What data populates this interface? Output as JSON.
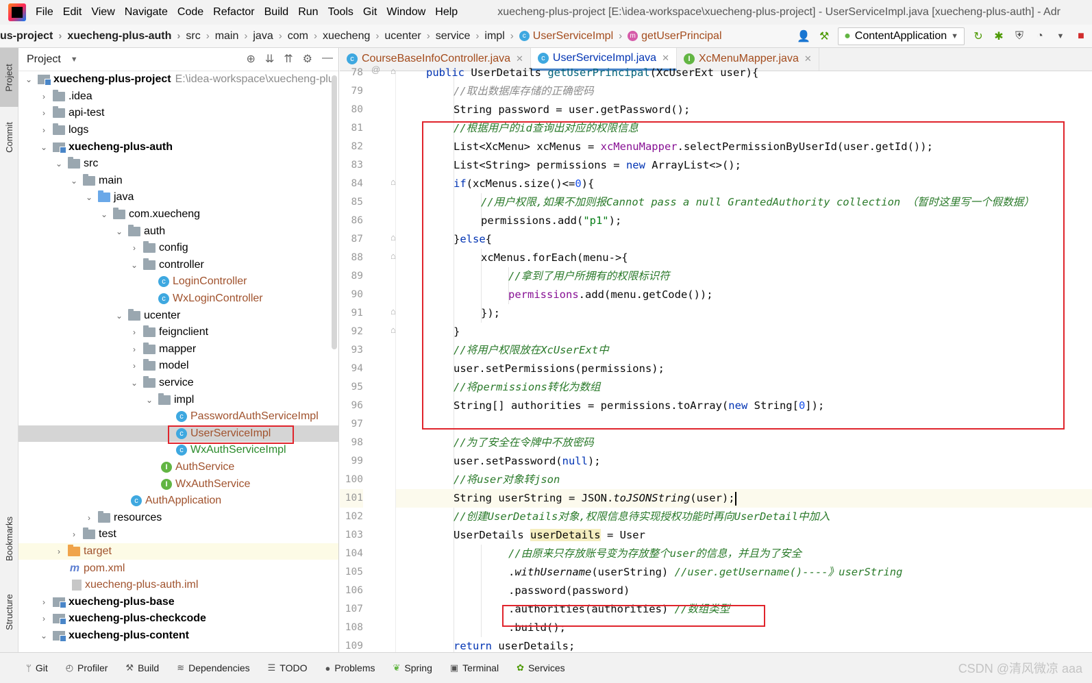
{
  "window_title": "xuecheng-plus-project [E:\\idea-workspace\\xuecheng-plus-project] - UserServiceImpl.java [xuecheng-plus-auth] - Adr",
  "menu": [
    "File",
    "Edit",
    "View",
    "Navigate",
    "Code",
    "Refactor",
    "Build",
    "Run",
    "Tools",
    "Git",
    "Window",
    "Help"
  ],
  "breadcrumbs": [
    "us-project",
    "xuecheng-plus-auth",
    "src",
    "main",
    "java",
    "com",
    "xuecheng",
    "ucenter",
    "service",
    "impl",
    "UserServiceImpl",
    "getUserPrincipal"
  ],
  "run_config": "ContentApplication",
  "left_strip": {
    "project": "Project",
    "commit": "Commit",
    "bookmarks": "Bookmarks",
    "structure": "Structure"
  },
  "project_panel": {
    "title": "Project",
    "tree": [
      {
        "label": "xuecheng-plus-project",
        "path": "E:\\idea-workspace\\xuecheng-plu"
      },
      {
        "label": ".idea"
      },
      {
        "label": "api-test"
      },
      {
        "label": "logs"
      },
      {
        "label": "xuecheng-plus-auth"
      },
      {
        "label": "src"
      },
      {
        "label": "main"
      },
      {
        "label": "java"
      },
      {
        "label": "com.xuecheng"
      },
      {
        "label": "auth"
      },
      {
        "label": "config"
      },
      {
        "label": "controller"
      },
      {
        "label": "LoginController"
      },
      {
        "label": "WxLoginController"
      },
      {
        "label": "ucenter"
      },
      {
        "label": "feignclient"
      },
      {
        "label": "mapper"
      },
      {
        "label": "model"
      },
      {
        "label": "service"
      },
      {
        "label": "impl"
      },
      {
        "label": "PasswordAuthServiceImpl"
      },
      {
        "label": "UserServiceImpl"
      },
      {
        "label": "WxAuthServiceImpl"
      },
      {
        "label": "AuthService"
      },
      {
        "label": "WxAuthService"
      },
      {
        "label": "AuthApplication"
      },
      {
        "label": "resources"
      },
      {
        "label": "test"
      },
      {
        "label": "target"
      },
      {
        "label": "pom.xml"
      },
      {
        "label": "xuecheng-plus-auth.iml"
      },
      {
        "label": "xuecheng-plus-base"
      },
      {
        "label": "xuecheng-plus-checkcode"
      },
      {
        "label": "xuecheng-plus-content"
      }
    ]
  },
  "editor_tabs": [
    "CourseBaseInfoController.java",
    "UserServiceImpl.java",
    "XcMenuMapper.java"
  ],
  "line_numbers": [
    "78",
    "79",
    "80",
    "81",
    "82",
    "83",
    "84",
    "85",
    "86",
    "87",
    "88",
    "89",
    "90",
    "91",
    "92",
    "93",
    "94",
    "95",
    "96",
    "97",
    "98",
    "99",
    "100",
    "101",
    "102",
    "103",
    "104",
    "105",
    "106",
    "107",
    "108",
    "109"
  ],
  "code": {
    "l78": {
      "a": "public",
      "b": " UserDetails ",
      "c": "getUserPrincipal",
      "d": "(XcUserExt user){"
    },
    "l79": "//取出数据库存储的正确密码",
    "l80": {
      "a": "String password = user.getPassword();"
    },
    "l81": "//根据用户的id查询出对应的权限信息",
    "l82": {
      "a": "List<XcMenu> xcMenus = ",
      "b": "xcMenuMapper",
      "c": ".selectPermissionByUserId(user.getId());"
    },
    "l83": {
      "a": "List<String> permissions = ",
      "b": "new",
      "c": " ArrayList<>();"
    },
    "l84": {
      "a": "if",
      "b": "(xcMenus.size()<=",
      "c": "0",
      "d": "){"
    },
    "l85": "//用户权限,如果不加则报Cannot pass a null GrantedAuthority collection （暂时这里写一个假数据）",
    "l86": {
      "a": "permissions.add(",
      "b": "\"p1\"",
      "c": ");"
    },
    "l87": {
      "a": "}",
      "b": "else",
      "c": "{"
    },
    "l88": {
      "a": "xcMenus.forEach(menu->{"
    },
    "l89": "//拿到了用户所拥有的权限标识符",
    "l90": {
      "a": "permissions",
      "b": ".add(menu.getCode());"
    },
    "l91": "});",
    "l92": "}",
    "l93": "//将用户权限放在XcUserExt中",
    "l94": "user.setPermissions(permissions);",
    "l95": "//将permissions转化为数组",
    "l96": {
      "a": "String[] authorities = permissions.toArray(",
      "b": "new",
      "c": " String[",
      "d": "0",
      "e": "]);"
    },
    "l97": "",
    "l98": "//为了安全在令牌中不放密码",
    "l99": {
      "a": "user.setPassword(",
      "b": "null",
      "c": ");"
    },
    "l100": "//将user对象转json",
    "l101": {
      "a": "String userString = JSON.",
      "b": "toJSONString",
      "c": "(user);"
    },
    "l102": "//创建UserDetails对象,权限信息待实现授权功能时再向UserDetail中加入",
    "l103": {
      "a": "UserDetails ",
      "b": "userDetails",
      "c": " = User"
    },
    "l104": "//由原来只存放账号变为存放整个user的信息，并且为了安全",
    "l105": {
      "a": ".",
      "b": "withUsername",
      "c": "(userString) ",
      "d": "//user.getUsername()----》userString"
    },
    "l106": ".password(password)",
    "l107": {
      "a": ".authorities(authorities) ",
      "b": "//数组类型"
    },
    "l108": ".build();",
    "l109": {
      "a": "return",
      "b": " userDetails;"
    }
  },
  "bottom_bar": [
    "Git",
    "Profiler",
    "Build",
    "Dependencies",
    "TODO",
    "Problems",
    "Spring",
    "Terminal",
    "Services"
  ],
  "watermark": "CSDN @清风微凉 aaa",
  "colors": {
    "highlight_box": "#e0242c",
    "keyword": "#0033b3",
    "field": "#871094",
    "comment_green": "#2a7a2a"
  }
}
